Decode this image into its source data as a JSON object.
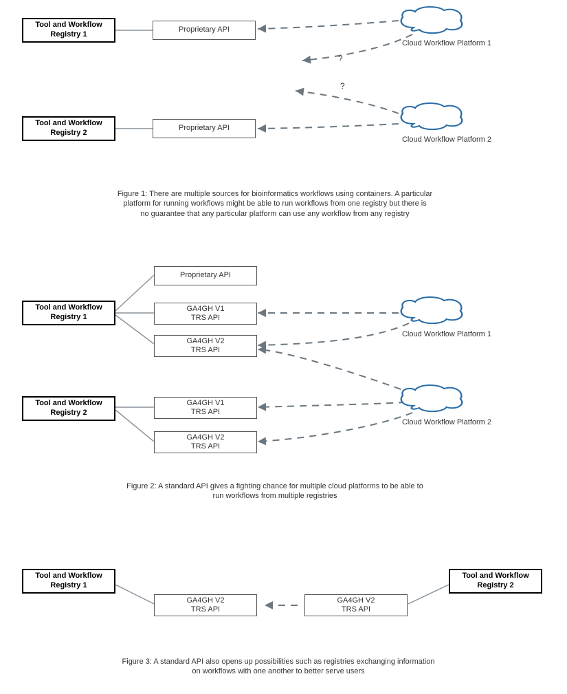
{
  "figure1": {
    "registry1": "Tool and Workflow\nRegistry 1",
    "registry2": "Tool and Workflow\nRegistry 2",
    "api1": "Proprietary API",
    "api2": "Proprietary API",
    "platform1": "Cloud Workflow Platform 1",
    "platform2": "Cloud Workflow Platform 2",
    "q1": "?",
    "q2": "?",
    "caption": "Figure 1: There are multiple sources for bioinformatics workflows using containers. A particular\nplatform for running workflows might be able to run workflows from one registry but there is\nno guarantee that any particular platform can use any workflow from any registry"
  },
  "figure2": {
    "registry1": "Tool and Workflow\nRegistry 1",
    "registry2": "Tool and Workflow\nRegistry 2",
    "api_prop": "Proprietary API",
    "api_v1_a": "GA4GH V1\nTRS API",
    "api_v2_a": "GA4GH V2\nTRS API",
    "api_v1_b": "GA4GH V1\nTRS API",
    "api_v2_b": "GA4GH V2\nTRS API",
    "platform1": "Cloud Workflow Platform 1",
    "platform2": "Cloud Workflow Platform 2",
    "caption": "Figure 2:  A standard API gives a fighting chance for multiple cloud platforms to be able to\nrun workflows from multiple registries"
  },
  "figure3": {
    "registry1": "Tool and Workflow\nRegistry 1",
    "registry2": "Tool and Workflow\nRegistry 2",
    "api_a": "GA4GH V2\nTRS API",
    "api_b": "GA4GH V2\nTRS API",
    "caption": "Figure 3:  A standard API also opens up possibilities such as registries exchanging information\non workflows with one another to better serve users"
  }
}
